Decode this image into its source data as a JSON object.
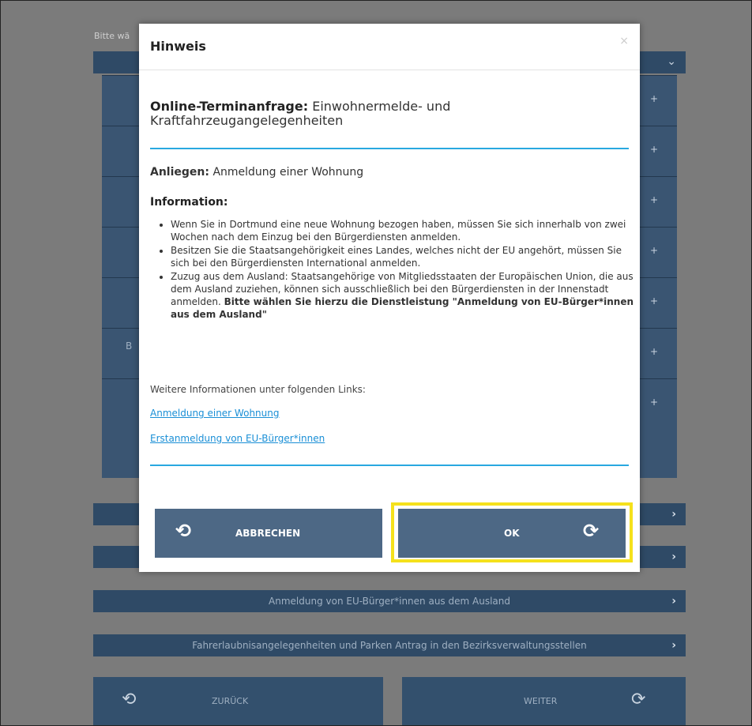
{
  "background": {
    "prompt_label": "Bitte wä",
    "side_label": "B",
    "bars": [
      {
        "label": ""
      },
      {
        "label": ""
      },
      {
        "label": "Anmeldung von EU-Bürger*innen aus dem Ausland"
      },
      {
        "label": "Fahrerlaubnisangelegenheiten und Parken Antrag in den Bezirksverwaltungsstellen"
      }
    ],
    "back_label": "ZURÜCK",
    "next_label": "WEITER"
  },
  "modal": {
    "title": "Hinweis",
    "service_prefix": "Online-Terminanfrage:",
    "service_text": "Einwohnermelde- und Kraftfahrzeugangelegenheiten",
    "anliegen_prefix": "Anliegen:",
    "anliegen_text": "Anmeldung einer Wohnung",
    "info_heading": "Information:",
    "bullets": [
      "Wenn Sie in Dortmund eine neue Wohnung bezogen haben, müssen Sie sich innerhalb von zwei Wochen nach dem Einzug bei den Bürgerdiensten anmelden.",
      "Besitzen Sie die Staatsangehörigkeit eines Landes, welches nicht der EU angehört, müssen Sie sich bei den Bürgerdiensten International anmelden."
    ],
    "bullet3_text": "Zuzug aus dem Ausland: Staatsangehörige von Mitgliedsstaaten der Europäischen Union, die aus dem Ausland zuziehen, können sich ausschließlich bei den Bürgerdiensten in der Innenstadt anmelden.",
    "bullet3_bold": "Bitte wählen Sie hierzu die Dienstleistung \"Anmeldung von EU-Bürger*innen aus dem Ausland\"",
    "more_info": "Weitere Informationen unter folgenden Links:",
    "link1": "Anmeldung einer Wohnung",
    "link2": "Erstanmeldung von EU-Bürger*innen",
    "cancel_label": "ABBRECHEN",
    "ok_label": "OK",
    "highlight_color": "#f5e11c",
    "accent_color": "#29a8e0"
  }
}
